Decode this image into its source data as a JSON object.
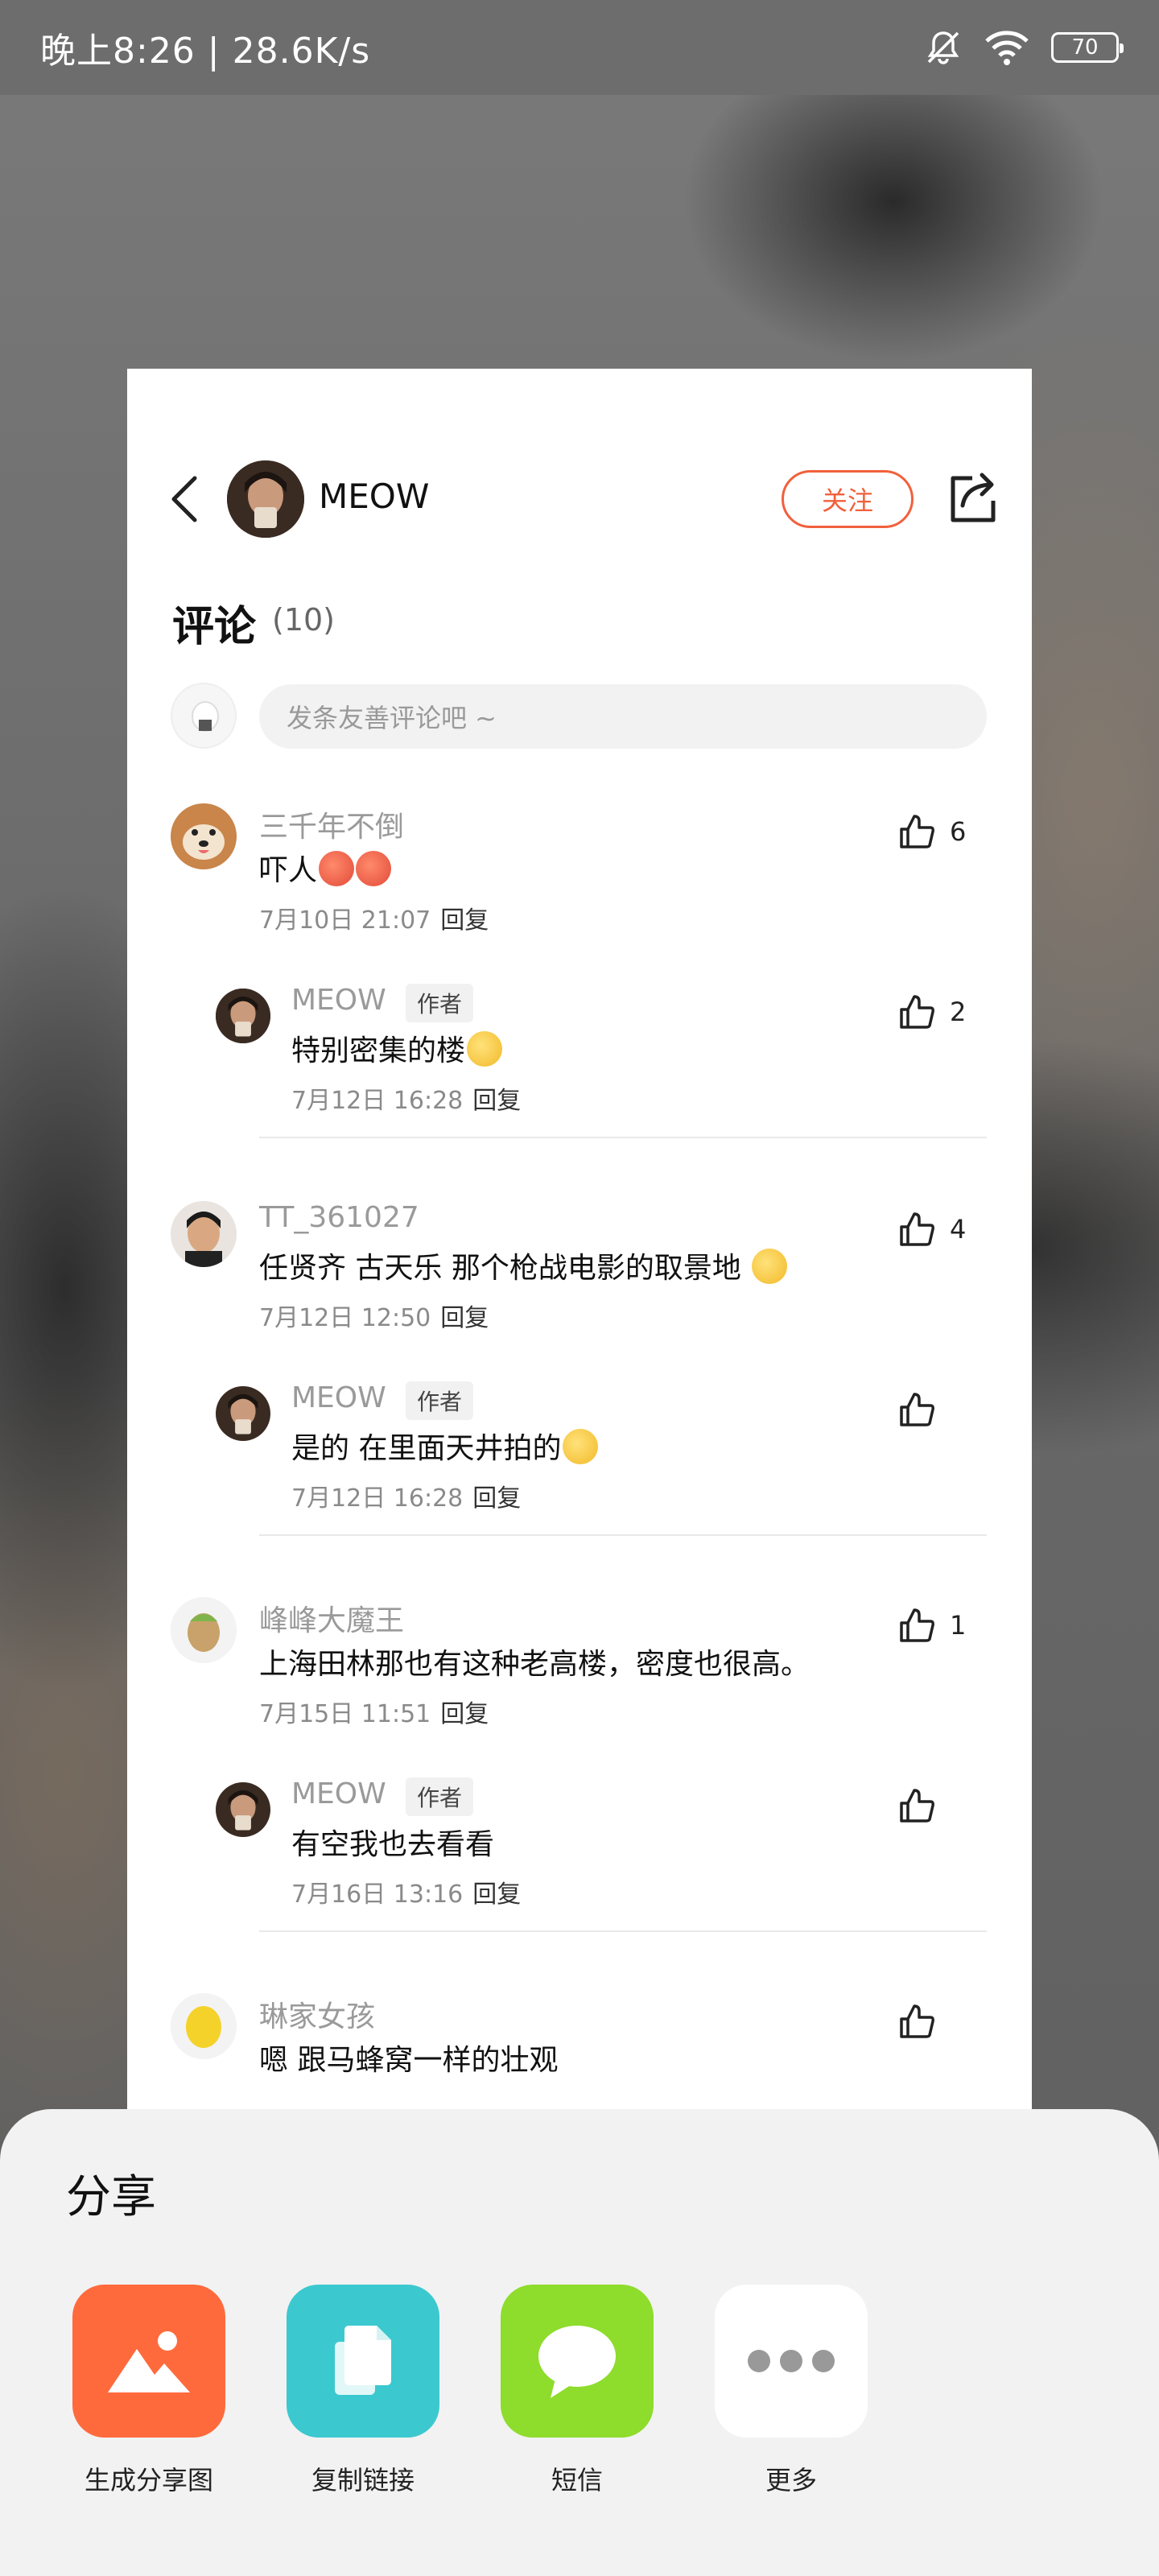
{
  "status_bar": {
    "time": "晚上8:26 | 28.6K/s",
    "battery": "70"
  },
  "header": {
    "author": "MEOW",
    "follow_label": "关注"
  },
  "comments_section": {
    "title": "评论",
    "count": "(10)",
    "input_placeholder": "发条友善评论吧 ~"
  },
  "comments": [
    {
      "name": "三千年不倒",
      "text": "吓人",
      "date": "7月10日  21:07",
      "reply": "回复",
      "likes": "6",
      "reply_item": {
        "name": "MEOW",
        "tag": "作者",
        "text": "特别密集的楼",
        "date": "7月12日  16:28",
        "reply": "回复",
        "likes": "2"
      }
    },
    {
      "name": "TT_361027",
      "text": "任贤齐 古天乐 那个枪战电影的取景地 ",
      "date": "7月12日  12:50",
      "reply": "回复",
      "likes": "4",
      "reply_item": {
        "name": "MEOW",
        "tag": "作者",
        "text": "是的 在里面天井拍的",
        "date": "7月12日  16:28",
        "reply": "回复",
        "likes": ""
      }
    },
    {
      "name": "峰峰大魔王",
      "text": "上海田林那也有这种老高楼，密度也很高。",
      "date": "7月15日  11:51",
      "reply": "回复",
      "likes": "1",
      "reply_item": {
        "name": "MEOW",
        "tag": "作者",
        "text": "有空我也去看看",
        "date": "7月16日  13:16",
        "reply": "回复",
        "likes": ""
      }
    },
    {
      "name": "琳家女孩",
      "text": "嗯 跟马蜂窝一样的壮观"
    }
  ],
  "share_sheet": {
    "title": "分享",
    "items": [
      {
        "label": "生成分享图",
        "icon": "image-icon",
        "color": "#ff6a3d"
      },
      {
        "label": "复制链接",
        "icon": "copy-link-icon",
        "color": "#3cc8cf"
      },
      {
        "label": "短信",
        "icon": "sms-icon",
        "color": "#8edc2c"
      },
      {
        "label": "更多",
        "icon": "more-icon",
        "color": "#ffffff"
      }
    ]
  }
}
